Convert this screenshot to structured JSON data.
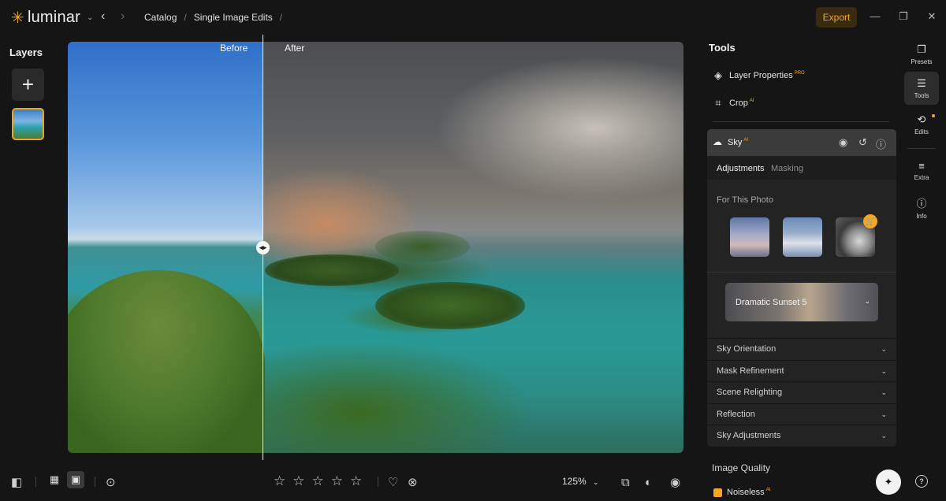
{
  "app": {
    "name": "luminar"
  },
  "breadcrumbs": [
    "Catalog",
    "Single Image Edits"
  ],
  "export_label": "Export",
  "left_panel": {
    "title": "Layers"
  },
  "compare": {
    "before": "Before",
    "after": "After"
  },
  "bottom": {
    "zoom": "125%"
  },
  "tools": {
    "title": "Tools",
    "layer_properties": "Layer Properties",
    "layer_properties_badge": "PRO",
    "crop": "Crop",
    "crop_badge": "AI"
  },
  "sky": {
    "title": "Sky",
    "badge": "AI",
    "tabs": [
      "Adjustments",
      "Masking"
    ],
    "for_this_photo": "For This Photo",
    "selected_preset": "Dramatic Sunset 5",
    "sections": [
      "Sky Orientation",
      "Mask Refinement",
      "Scene Relighting",
      "Reflection",
      "Sky Adjustments"
    ]
  },
  "image_quality": {
    "title": "Image Quality",
    "noiseless": "Noiseless",
    "noiseless_badge": "AI"
  },
  "rail": {
    "presets": "Presets",
    "tools": "Tools",
    "edits": "Edits",
    "extra": "Extra",
    "info": "Info"
  },
  "colors": {
    "accent": "#f5a623",
    "panel": "#232323",
    "header": "#3b3b3b"
  }
}
